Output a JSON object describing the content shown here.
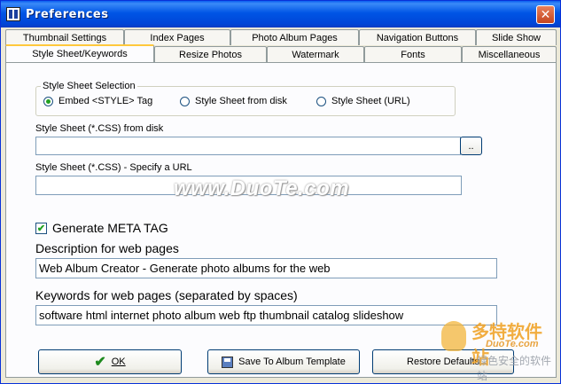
{
  "window": {
    "title": "Preferences",
    "close_glyph": "✕"
  },
  "tabs_row1": [
    "Thumbnail Settings",
    "Index Pages",
    "Photo Album Pages",
    "Navigation Buttons",
    "Slide Show"
  ],
  "tabs_row2": [
    "Style Sheet/Keywords",
    "Resize Photos",
    "Watermark",
    "Fonts",
    "Miscellaneous"
  ],
  "active_tab": "Style Sheet/Keywords",
  "style_sheet_selection": {
    "group_label": "Style Sheet Selection",
    "options": [
      "Embed <STYLE> Tag",
      "Style Sheet from disk",
      "Style Sheet (URL)"
    ],
    "selected": "Embed <STYLE> Tag"
  },
  "css_disk": {
    "label": "Style Sheet (*.CSS) from disk",
    "value": "",
    "browse_label": ".."
  },
  "css_url": {
    "label": "Style Sheet (*.CSS) - Specify a URL",
    "value": ""
  },
  "meta": {
    "checkbox_label": "Generate META TAG",
    "checked": true
  },
  "description": {
    "label": "Description for web pages",
    "value": "Web Album Creator - Generate photo albums for the web"
  },
  "keywords": {
    "label": "Keywords for web pages (separated by spaces)",
    "value": "software html internet photo album web ftp thumbnail catalog slideshow"
  },
  "buttons": {
    "ok": "OK",
    "save_template": "Save To Album Template",
    "restore": "Restore Defaults"
  },
  "watermarks": {
    "main": "www.DuoTe.com",
    "corner_cn": "多特软件站",
    "corner_url": "DuoTe.com",
    "corner_cn2": "绿色安全的软件站"
  },
  "colors": {
    "titlebar": "#0055E5",
    "dialog_bg": "#ECE9D8",
    "panel_bg": "#FCFCFE",
    "active_tab_accent": "#FFC83C",
    "radio_selected": "#21A121",
    "close_button": "#C4451F"
  },
  "icons": {
    "app": "book-icon",
    "close": "close-icon",
    "ok": "checkmark-icon",
    "save": "floppy-disk-icon"
  }
}
